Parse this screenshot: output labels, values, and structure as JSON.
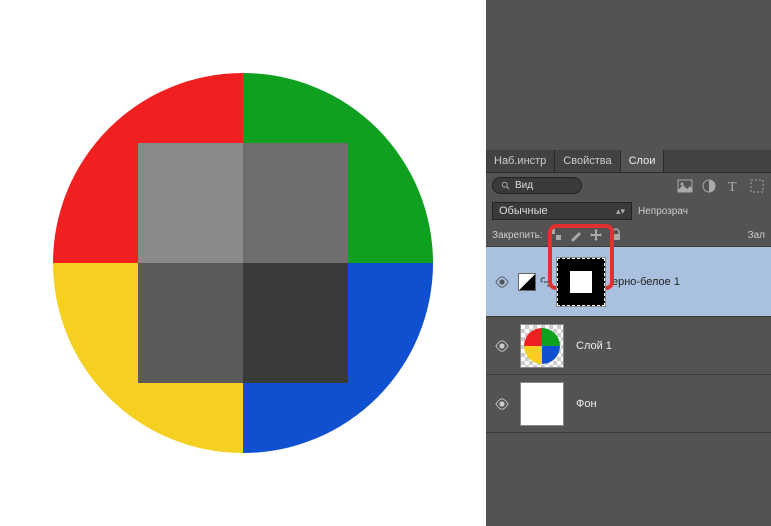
{
  "tabs": {
    "tools": "Наб.инстр",
    "properties": "Свойства",
    "layers": "Слои"
  },
  "search": {
    "label": "Вид"
  },
  "blend": {
    "mode": "Обычные",
    "opacity_label": "Непрозрач"
  },
  "lock": {
    "label": "Закрепить:",
    "fill_label": "Зал"
  },
  "layers": [
    {
      "name": "ерно-белое 1"
    },
    {
      "name": "Слой 1"
    },
    {
      "name": "Фон"
    }
  ],
  "colors": {
    "red": "#f02020",
    "green": "#0fa020",
    "blue": "#0f50d0",
    "yellow": "#f5d020",
    "gray1": "#8a8a8a",
    "gray2": "#6e6e6e",
    "gray3": "#5a5a5a",
    "gray4": "#3a3a3a"
  }
}
